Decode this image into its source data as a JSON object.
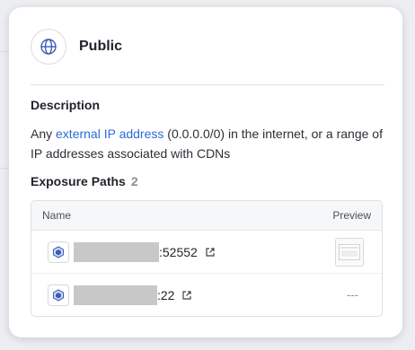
{
  "panel": {
    "title": "Public",
    "description_heading": "Description",
    "description_pre": "Any ",
    "description_link": "external IP address",
    "description_post": " (0.0.0.0/0) in the internet, or a range of IP addresses associated with CDNs",
    "exposure_heading": "Exposure Paths",
    "exposure_count": "2"
  },
  "table": {
    "columns": [
      "Name",
      "Preview"
    ],
    "rows": [
      {
        "port": ":52552",
        "preview": "thumbnail"
      },
      {
        "port": ":22",
        "preview": "---"
      }
    ]
  },
  "icons": {
    "header": "globe-icon",
    "asset": "host-icon",
    "open": "external-link-icon"
  },
  "colors": {
    "link": "#2b6cd4",
    "redaction": "#c8c8c8"
  }
}
